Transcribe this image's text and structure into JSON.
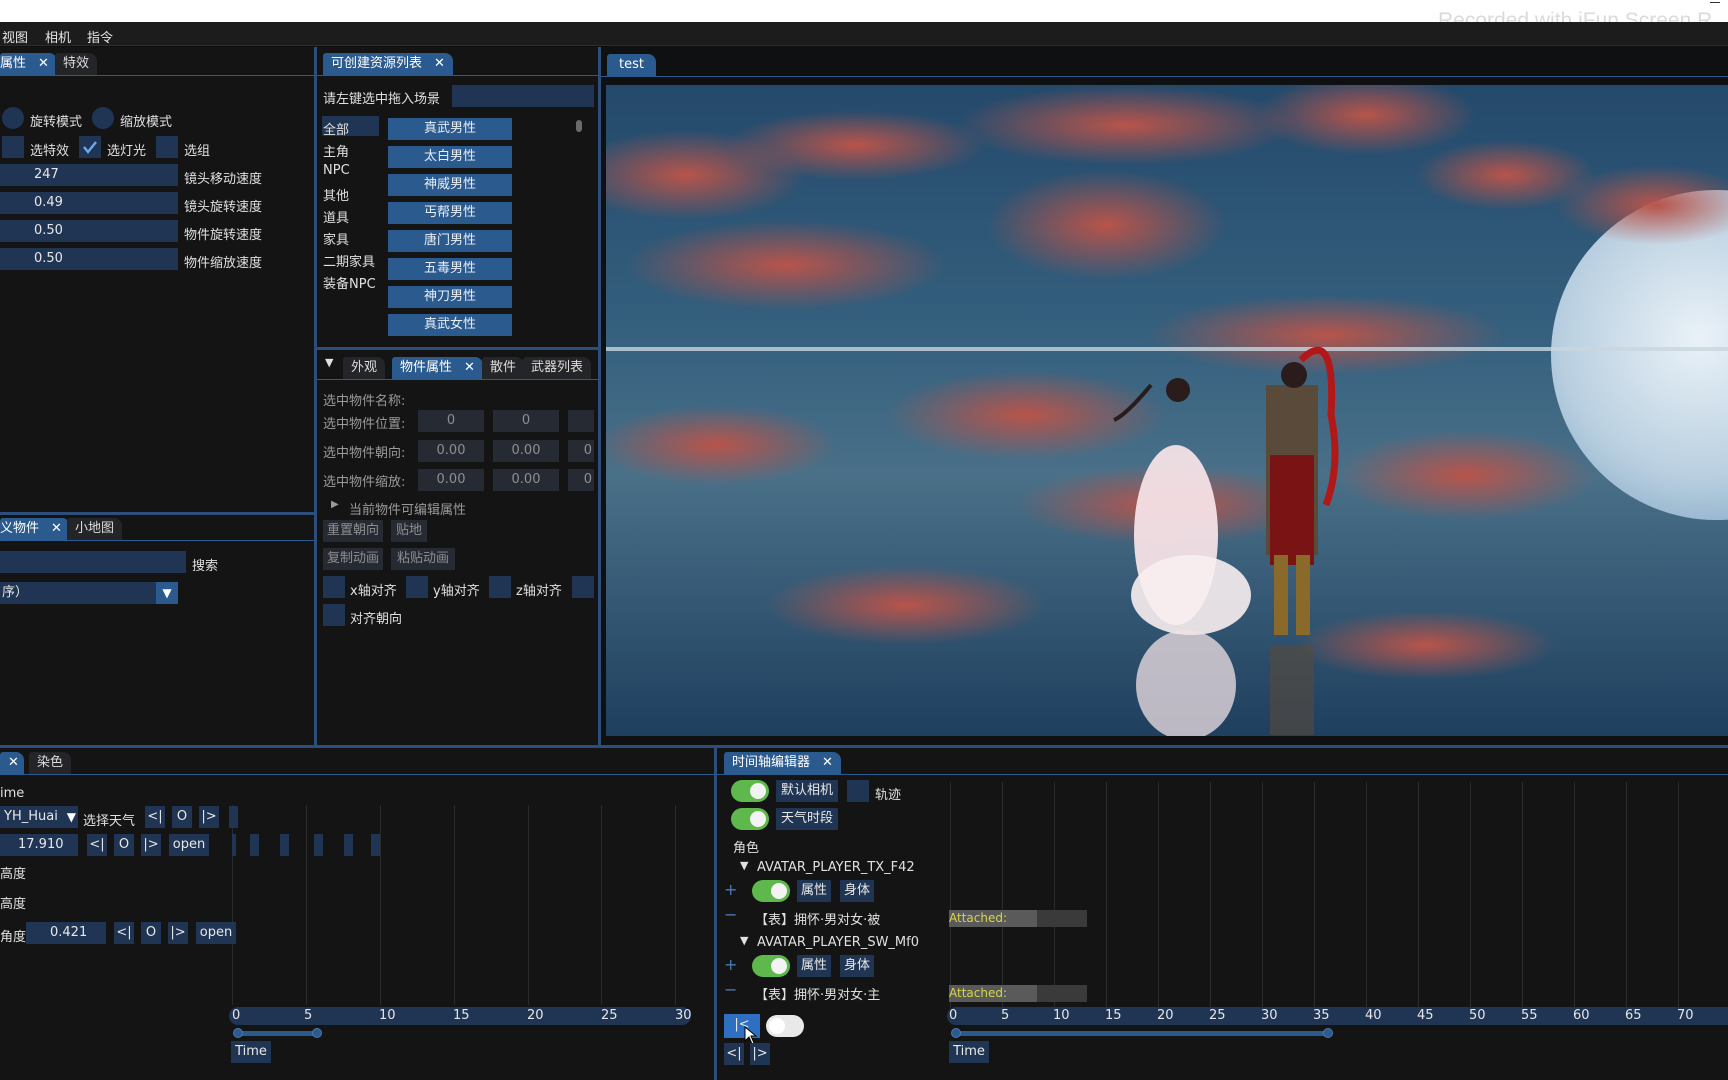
{
  "watermark": "Recorded with iFun Screen R",
  "menu": [
    "视图",
    "相机",
    "指令"
  ],
  "left_panel": {
    "tabs": [
      {
        "label": "属性",
        "closable": true
      },
      {
        "label": "特效"
      }
    ],
    "radios": [
      "旋转模式",
      "缩放模式"
    ],
    "checks": [
      {
        "label": "选特效",
        "checked": false
      },
      {
        "label": "选灯光",
        "checked": true
      },
      {
        "label": "选组",
        "checked": false
      }
    ],
    "speeds": [
      {
        "value": "247",
        "label": "镜头移动速度"
      },
      {
        "value": "0.49",
        "label": "镜头旋转速度"
      },
      {
        "value": "0.50",
        "label": "物件旋转速度"
      },
      {
        "value": "0.50",
        "label": "物件缩放速度"
      }
    ],
    "lower_tabs": [
      {
        "label": "义物件",
        "closable": true
      },
      {
        "label": "小地图"
      }
    ],
    "search_label": "搜索",
    "sort_value": "序）"
  },
  "resource_panel": {
    "tab": "可创建资源列表",
    "hint": "请左键选中拖入场景",
    "categories": [
      "全部",
      "主角",
      "NPC",
      "其他",
      "道具",
      "家具",
      "二期家具",
      "装备NPC"
    ],
    "items": [
      "真武男性",
      "太白男性",
      "神威男性",
      "丐帮男性",
      "唐门男性",
      "五毒男性",
      "神刀男性",
      "真武女性"
    ]
  },
  "props_panel": {
    "tabs": [
      "外观",
      "物件属性",
      "散件",
      "武器列表"
    ],
    "name_label": "选中物件名称:",
    "rows": [
      {
        "label": "选中物件位置:",
        "values": [
          "0",
          "0",
          ""
        ]
      },
      {
        "label": "选中物件朝向:",
        "values": [
          "0.00",
          "0.00",
          "0"
        ]
      },
      {
        "label": "选中物件缩放:",
        "values": [
          "0.00",
          "0.00",
          "0"
        ]
      }
    ],
    "editable_label": "当前物件可编辑属性",
    "buttons": [
      "重置朝向",
      "贴地",
      "复制动画",
      "粘贴动画"
    ],
    "axis": [
      "x轴对齐",
      "y轴对齐",
      "z轴对齐"
    ],
    "align_dir": "对齐朝向"
  },
  "viewport": {
    "tab": "test"
  },
  "weather_panel": {
    "tab": "染色",
    "time_label": "ime",
    "avatar_select": "YH_Huai",
    "choose_weather": "选择天气",
    "time_value": "17.910",
    "open_label": "open",
    "rows": [
      "高度",
      "高度",
      "角度"
    ],
    "angle_value": "0.421",
    "ruler": [
      "0",
      "5",
      "10",
      "15",
      "20",
      "25",
      "30"
    ],
    "time_btn": "Time",
    "ctrl": [
      "<|",
      "O",
      "|>"
    ]
  },
  "timeline_panel": {
    "tab": "时间轴编辑器",
    "default_camera": "默认相机",
    "trajectory": "轨迹",
    "weather_period": "天气时段",
    "role_label": "角色",
    "avatars": [
      {
        "name": "AVATAR_PLAYER_TX_F42",
        "clip": "【表】拥怀·男对女·被",
        "attached": "Attached:"
      },
      {
        "name": "AVATAR_PLAYER_SW_Mf0",
        "clip": "【表】拥怀·男对女·主",
        "attached": "Attached:"
      }
    ],
    "attr_btn": "属性",
    "body_btn": "身体",
    "ruler": [
      "0",
      "5",
      "10",
      "15",
      "20",
      "25",
      "30",
      "35",
      "40",
      "45",
      "50",
      "55",
      "60",
      "65",
      "70"
    ],
    "time_btn": "Time",
    "play_btn": "|<",
    "prev_btn": "<|",
    "next_btn": "|>"
  }
}
